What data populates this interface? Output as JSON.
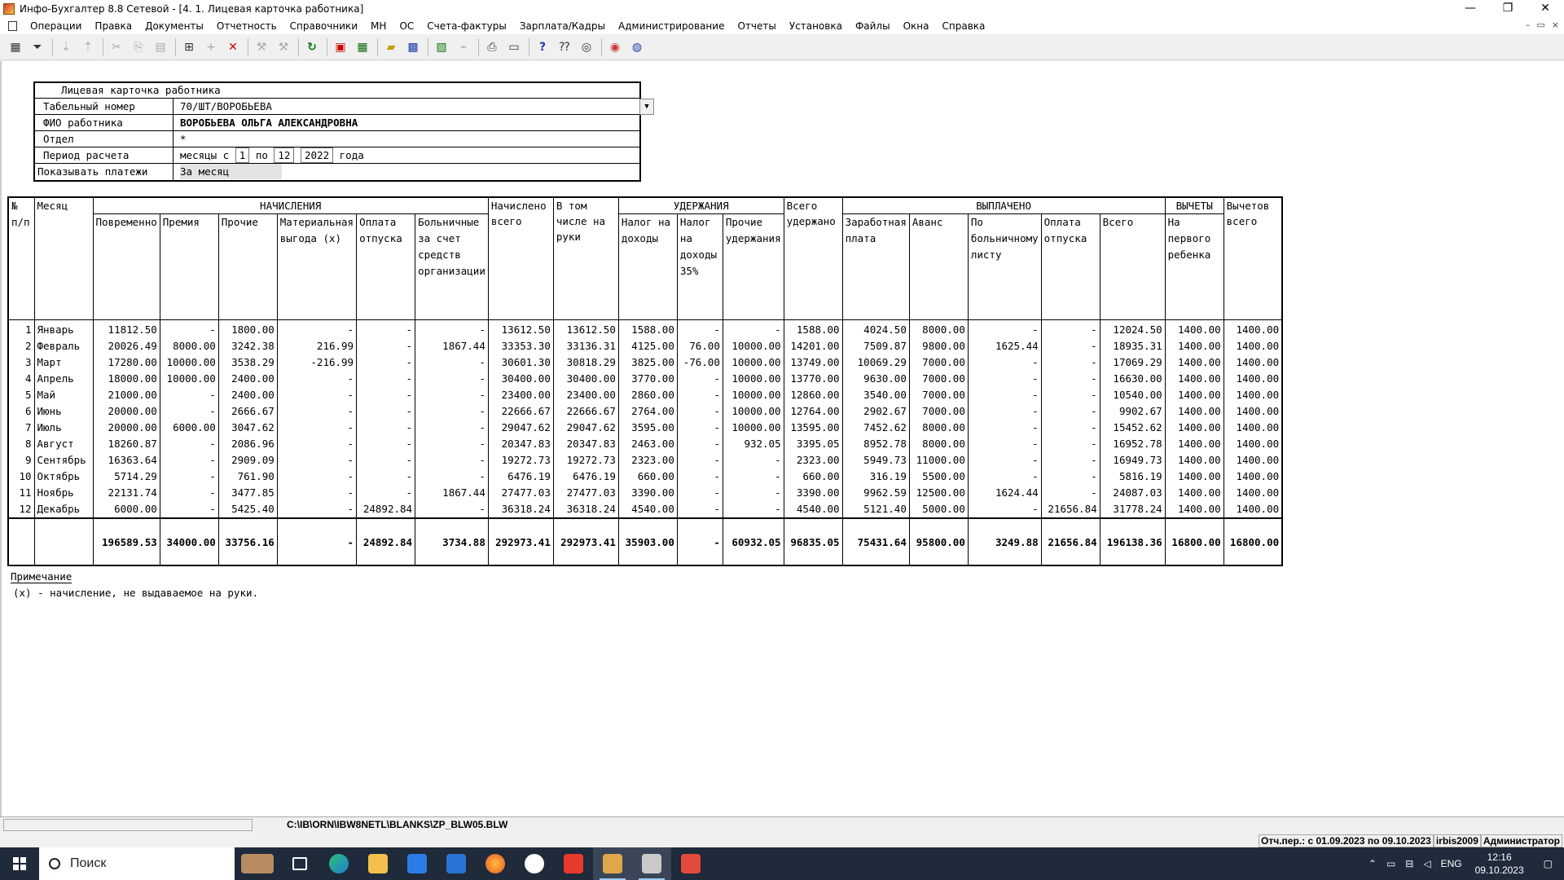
{
  "window": {
    "title": "Инфо-Бухгалтер 8.8 Сетевой - [4. 1. Лицевая карточка работника]",
    "controls": [
      "—",
      "❐",
      "✕"
    ]
  },
  "menu": [
    "Операции",
    "Правка",
    "Документы",
    "Отчетность",
    "Справочники",
    "МН",
    "ОС",
    "Счета-фактуры",
    "Зарплата/Кадры",
    "Администрирование",
    "Отчеты",
    "Установка",
    "Файлы",
    "Окна",
    "Справка"
  ],
  "mdi_controls": [
    "–",
    "▭",
    "×"
  ],
  "toolbar_icons": [
    "preview-icon",
    "filter-icon",
    "sort-asc-icon",
    "sort-desc-icon",
    "cut-icon",
    "copy-icon",
    "paste-icon",
    "calc-icon",
    "add-icon",
    "delete-icon",
    "tool1-icon",
    "tool2-icon",
    "refresh-icon",
    "pdf-icon",
    "table-icon",
    "open-folder-icon",
    "save-icon",
    "excel-icon",
    "broom-icon",
    "print-icon",
    "page-icon",
    "help-icon",
    "context-help-icon",
    "compass-icon",
    "web-icon",
    "globe-icon"
  ],
  "form": {
    "title": "Лицевая карточка работника",
    "tab_label": "Табельный номер",
    "tab_value": "70/ШТ/ВОРОБЬЕВА",
    "fio_label": "ФИО работника",
    "fio_value": "ВОРОБЬЕВА ОЛЬГА АЛЕКСАНДРОВНА",
    "dept_label": "Отдел",
    "dept_value": "*",
    "period_label": "Период расчета",
    "period_prefix": "месяцы  с",
    "period_from": "1",
    "period_to_label": "по",
    "period_to": "12",
    "year": "2022",
    "year_suffix": "года",
    "show_label": "Показывать платежи",
    "show_value": "За месяц"
  },
  "table": {
    "col_num": "№ п/п",
    "col_month": "Месяц",
    "group_accruals": "НАЧИСЛЕНИЯ",
    "group_withholdings": "УДЕРЖАНИЯ",
    "group_paid": "ВЫПЛАЧЕНО",
    "group_deductions": "ВЫЧЕТЫ",
    "accrual_cols": [
      "Повременно",
      "Премия",
      "Прочие",
      "Материальная выгода (х)",
      "Оплата отпуска",
      "Больничные за счет средств организации"
    ],
    "col_accrued_total": "Начислено всего",
    "col_to_hand": "В том числе на руки",
    "withholding_cols": [
      "Налог на доходы",
      "Налог на доходы 35%",
      "Прочие удержания"
    ],
    "col_withheld_total": "Всего удержано",
    "paid_cols": [
      "Заработная плата",
      "Аванс",
      "По больничному листу",
      "Оплата отпуска",
      "Всего"
    ],
    "deduction_cols": [
      "На первого ребенка"
    ],
    "col_deductions_total": "Вычетов всего",
    "rows": [
      [
        "1",
        "Январь",
        "11812.50",
        "-",
        "1800.00",
        "-",
        "-",
        "-",
        "13612.50",
        "13612.50",
        "1588.00",
        "-",
        "-",
        "1588.00",
        "4024.50",
        "8000.00",
        "-",
        "-",
        "12024.50",
        "1400.00",
        "1400.00"
      ],
      [
        "2",
        "Февраль",
        "20026.49",
        "8000.00",
        "3242.38",
        "216.99",
        "-",
        "1867.44",
        "33353.30",
        "33136.31",
        "4125.00",
        "76.00",
        "10000.00",
        "14201.00",
        "7509.87",
        "9800.00",
        "1625.44",
        "-",
        "18935.31",
        "1400.00",
        "1400.00"
      ],
      [
        "3",
        "Март",
        "17280.00",
        "10000.00",
        "3538.29",
        "-216.99",
        "-",
        "-",
        "30601.30",
        "30818.29",
        "3825.00",
        "-76.00",
        "10000.00",
        "13749.00",
        "10069.29",
        "7000.00",
        "-",
        "-",
        "17069.29",
        "1400.00",
        "1400.00"
      ],
      [
        "4",
        "Апрель",
        "18000.00",
        "10000.00",
        "2400.00",
        "-",
        "-",
        "-",
        "30400.00",
        "30400.00",
        "3770.00",
        "-",
        "10000.00",
        "13770.00",
        "9630.00",
        "7000.00",
        "-",
        "-",
        "16630.00",
        "1400.00",
        "1400.00"
      ],
      [
        "5",
        "Май",
        "21000.00",
        "-",
        "2400.00",
        "-",
        "-",
        "-",
        "23400.00",
        "23400.00",
        "2860.00",
        "-",
        "10000.00",
        "12860.00",
        "3540.00",
        "7000.00",
        "-",
        "-",
        "10540.00",
        "1400.00",
        "1400.00"
      ],
      [
        "6",
        "Июнь",
        "20000.00",
        "-",
        "2666.67",
        "-",
        "-",
        "-",
        "22666.67",
        "22666.67",
        "2764.00",
        "-",
        "10000.00",
        "12764.00",
        "2902.67",
        "7000.00",
        "-",
        "-",
        "9902.67",
        "1400.00",
        "1400.00"
      ],
      [
        "7",
        "Июль",
        "20000.00",
        "6000.00",
        "3047.62",
        "-",
        "-",
        "-",
        "29047.62",
        "29047.62",
        "3595.00",
        "-",
        "10000.00",
        "13595.00",
        "7452.62",
        "8000.00",
        "-",
        "-",
        "15452.62",
        "1400.00",
        "1400.00"
      ],
      [
        "8",
        "Август",
        "18260.87",
        "-",
        "2086.96",
        "-",
        "-",
        "-",
        "20347.83",
        "20347.83",
        "2463.00",
        "-",
        "932.05",
        "3395.05",
        "8952.78",
        "8000.00",
        "-",
        "-",
        "16952.78",
        "1400.00",
        "1400.00"
      ],
      [
        "9",
        "Сентябрь",
        "16363.64",
        "-",
        "2909.09",
        "-",
        "-",
        "-",
        "19272.73",
        "19272.73",
        "2323.00",
        "-",
        "-",
        "2323.00",
        "5949.73",
        "11000.00",
        "-",
        "-",
        "16949.73",
        "1400.00",
        "1400.00"
      ],
      [
        "10",
        "Октябрь",
        "5714.29",
        "-",
        "761.90",
        "-",
        "-",
        "-",
        "6476.19",
        "6476.19",
        "660.00",
        "-",
        "-",
        "660.00",
        "316.19",
        "5500.00",
        "-",
        "-",
        "5816.19",
        "1400.00",
        "1400.00"
      ],
      [
        "11",
        "Ноябрь",
        "22131.74",
        "-",
        "3477.85",
        "-",
        "-",
        "1867.44",
        "27477.03",
        "27477.03",
        "3390.00",
        "-",
        "-",
        "3390.00",
        "9962.59",
        "12500.00",
        "1624.44",
        "-",
        "24087.03",
        "1400.00",
        "1400.00"
      ],
      [
        "12",
        "Декабрь",
        "6000.00",
        "-",
        "5425.40",
        "-",
        "24892.84",
        "-",
        "36318.24",
        "36318.24",
        "4540.00",
        "-",
        "-",
        "4540.00",
        "5121.40",
        "5000.00",
        "-",
        "21656.84",
        "31778.24",
        "1400.00",
        "1400.00"
      ]
    ],
    "totals": [
      "",
      "",
      "196589.53",
      "34000.00",
      "33756.16",
      "-",
      "24892.84",
      "3734.88",
      "292973.41",
      "292973.41",
      "35903.00",
      "-",
      "60932.05",
      "96835.05",
      "75431.64",
      "95800.00",
      "3249.88",
      "21656.84",
      "196138.36",
      "16800.00",
      "16800.00"
    ]
  },
  "note": {
    "title": "Примечание",
    "text": "(х) - начисление, не выдаваемое на руки."
  },
  "pathbar": {
    "path": "C:\\IB\\ORN\\IBW8NETL\\BLANKS\\ZP_BLW05.BLW"
  },
  "status": {
    "period": "Отч.пер.: с 01.09.2023 по 09.10.2023",
    "db": "irbis2009",
    "user": "Администратор"
  },
  "taskbar": {
    "search_placeholder": "Поиск",
    "lang": "ENG",
    "time": "12:16",
    "date": "09.10.2023"
  },
  "colors": {
    "taskbar_bg": "#1f2a3a",
    "window_bg": "#ffffff",
    "chrome_bg": "#f0f0f0"
  }
}
